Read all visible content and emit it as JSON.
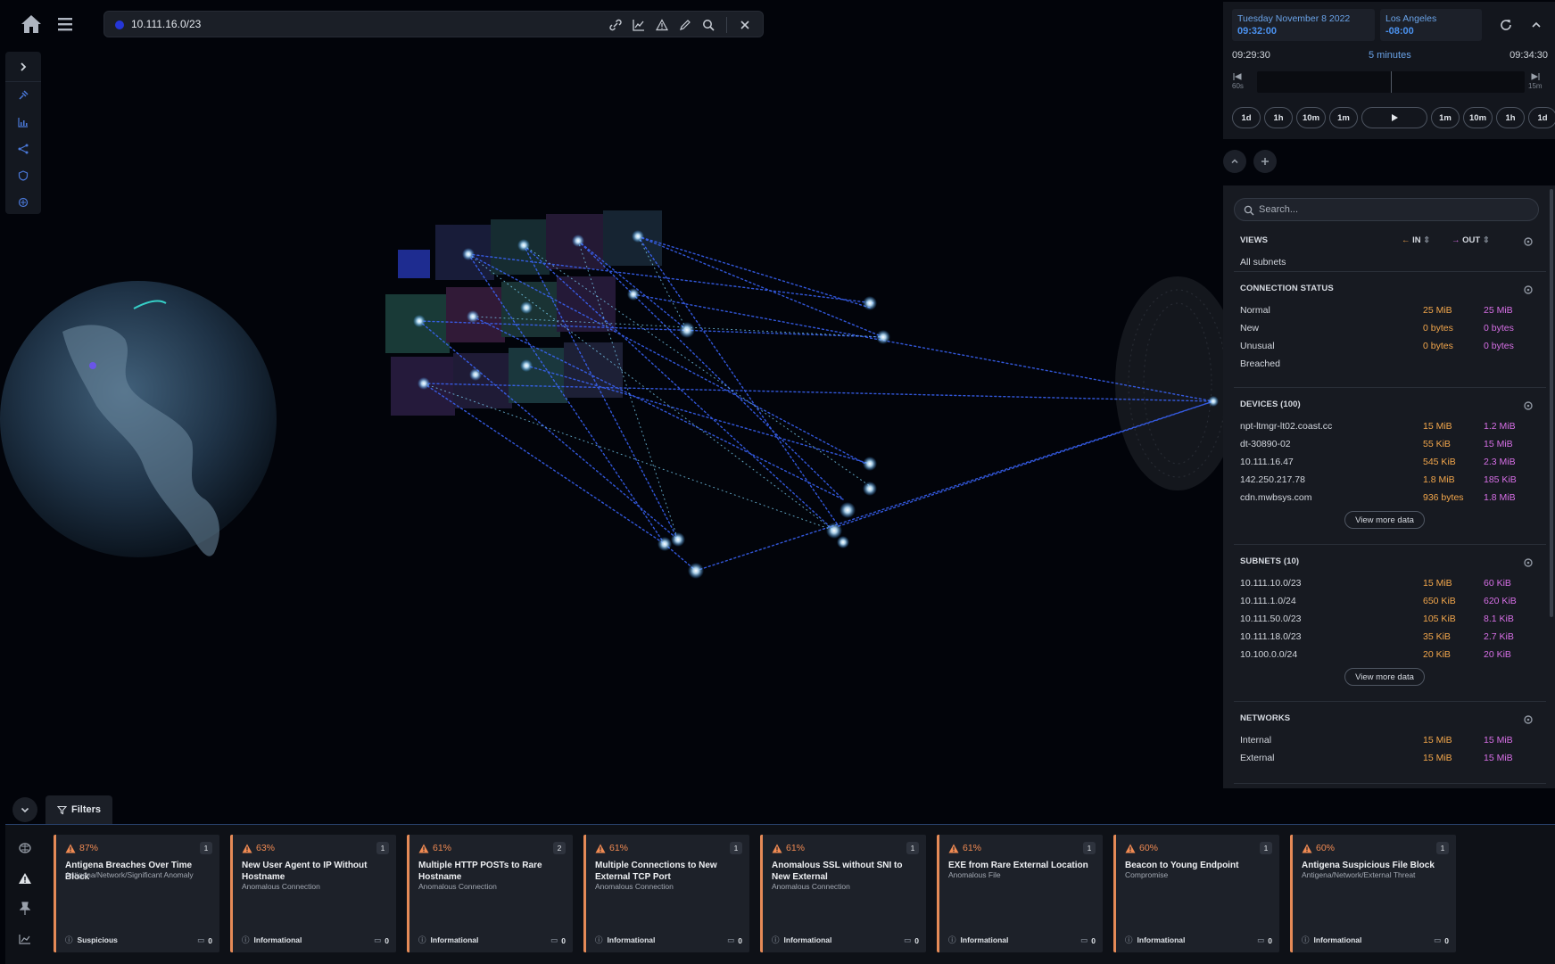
{
  "topbar": {
    "url_value": "10.111.16.0/23"
  },
  "header": {
    "date": "Tuesday November 8 2022",
    "time": "09:32:00",
    "timezone": "Los Angeles",
    "offset": "-08:00"
  },
  "timeline": {
    "start": "09:29:30",
    "window": "5 minutes",
    "end": "09:34:30",
    "left_jump": "60s",
    "right_jump": "15m",
    "steps": [
      "1d",
      "1h",
      "10m",
      "1m",
      "1m",
      "10m",
      "1h",
      "1d"
    ]
  },
  "panel": {
    "search_placeholder": "Search...",
    "in_label": "IN",
    "out_label": "OUT",
    "views": {
      "title": "VIEWS",
      "value": "All subnets"
    },
    "connection_status": {
      "title": "CONNECTION STATUS",
      "rows": [
        {
          "name": "Normal",
          "in": "25 MiB",
          "out": "25 MiB"
        },
        {
          "name": "New",
          "in": "0 bytes",
          "out": "0 bytes"
        },
        {
          "name": "Unusual",
          "in": "0 bytes",
          "out": "0 bytes"
        },
        {
          "name": "Breached",
          "in": "",
          "out": ""
        }
      ]
    },
    "devices": {
      "title": "DEVICES (100)",
      "rows": [
        {
          "name": "npt-ltmgr-lt02.coast.cc",
          "in": "15 MiB",
          "out": "1.2 MiB"
        },
        {
          "name": "dt-30890-02",
          "in": "55 KiB",
          "out": "15 MiB"
        },
        {
          "name": "10.111.16.47",
          "in": "545 KiB",
          "out": "2.3 MiB"
        },
        {
          "name": "142.250.217.78",
          "in": "1.8 MiB",
          "out": "185 KiB"
        },
        {
          "name": "cdn.mwbsys.com",
          "in": "936 bytes",
          "out": "1.8 MiB"
        }
      ],
      "more": "View more data"
    },
    "subnets": {
      "title": "SUBNETS (10)",
      "rows": [
        {
          "name": "10.111.10.0/23",
          "in": "15 MiB",
          "out": "60 KiB"
        },
        {
          "name": "10.111.1.0/24",
          "in": "650 KiB",
          "out": "620 KiB"
        },
        {
          "name": "10.111.50.0/23",
          "in": "105 KiB",
          "out": "8.1 KiB"
        },
        {
          "name": "10.111.18.0/23",
          "in": "35 KiB",
          "out": "2.7 KiB"
        },
        {
          "name": "10.100.0.0/24",
          "in": "20 KiB",
          "out": "20 KiB"
        }
      ],
      "more": "View more data"
    },
    "networks": {
      "title": "NETWORKS",
      "rows": [
        {
          "name": "Internal",
          "in": "15 MiB",
          "out": "15 MiB"
        },
        {
          "name": "External",
          "in": "15 MiB",
          "out": "15 MiB"
        }
      ]
    }
  },
  "filters": {
    "label": "Filters"
  },
  "alerts": [
    {
      "pct": "87%",
      "count": "1",
      "title": "Antigena Breaches Over Time Block",
      "sub": "Antigena/Network/Significant Anomaly",
      "status": "Suspicious",
      "comments": "0"
    },
    {
      "pct": "63%",
      "count": "1",
      "title": "New User Agent to IP Without Hostname",
      "sub": "Anomalous Connection",
      "status": "Informational",
      "comments": "0"
    },
    {
      "pct": "61%",
      "count": "2",
      "title": "Multiple HTTP POSTs to Rare Hostname",
      "sub": "Anomalous Connection",
      "status": "Informational",
      "comments": "0"
    },
    {
      "pct": "61%",
      "count": "1",
      "title": "Multiple Connections to New External TCP Port",
      "sub": "Anomalous Connection",
      "status": "Informational",
      "comments": "0"
    },
    {
      "pct": "61%",
      "count": "1",
      "title": "Anomalous SSL without SNI to New External",
      "sub": "Anomalous Connection",
      "status": "Informational",
      "comments": "0"
    },
    {
      "pct": "61%",
      "count": "1",
      "title": "EXE from Rare External Location",
      "sub": "Anomalous File",
      "status": "Informational",
      "comments": "0"
    },
    {
      "pct": "60%",
      "count": "1",
      "title": "Beacon to Young Endpoint",
      "sub": "Compromise",
      "status": "Informational",
      "comments": "0"
    },
    {
      "pct": "60%",
      "count": "1",
      "title": "Antigena Suspicious File Block",
      "sub": "Antigena/Network/External Threat",
      "status": "Informational",
      "comments": "0"
    }
  ],
  "colors": {
    "accent": "#4b92f0",
    "in": "#f2a64b",
    "out": "#d76fe6",
    "alert": "#e58a57"
  }
}
